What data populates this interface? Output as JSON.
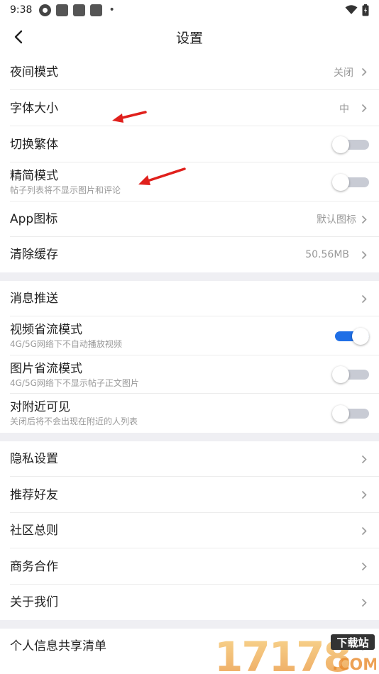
{
  "status": {
    "time": "9:38",
    "dot": "•"
  },
  "nav": {
    "title": "设置"
  },
  "section1": [
    {
      "title": "夜间模式",
      "value": "关闭"
    },
    {
      "title": "字体大小",
      "value": "中"
    },
    {
      "title": "切换繁体",
      "toggle": false
    },
    {
      "title": "精简模式",
      "subtitle": "帖子列表将不显示图片和评论",
      "toggle": false
    },
    {
      "title": "App图标",
      "value": "默认图标"
    },
    {
      "title": "清除缓存",
      "value": "50.56MB"
    }
  ],
  "section2": [
    {
      "title": "消息推送"
    },
    {
      "title": "视频省流模式",
      "subtitle": "4G/5G网络下不自动播放视频",
      "toggle": true
    },
    {
      "title": "图片省流模式",
      "subtitle": "4G/5G网络下不显示帖子正文图片",
      "toggle": false
    },
    {
      "title": "对附近可见",
      "subtitle": "关闭后将不会出现在附近的人列表",
      "toggle": false
    }
  ],
  "section3": [
    {
      "title": "隐私设置"
    },
    {
      "title": "推荐好友"
    },
    {
      "title": "社区总则"
    },
    {
      "title": "商务合作"
    },
    {
      "title": "关于我们"
    }
  ],
  "section4": [
    {
      "title": "个人信息共享清单"
    }
  ],
  "watermark": {
    "digits": "17178",
    "badge": "下载站",
    "domain": ".COM"
  },
  "colors": {
    "accent": "#1f6fe6",
    "annotation_arrow": "#e0201c",
    "section_gap": "#efeff3"
  }
}
